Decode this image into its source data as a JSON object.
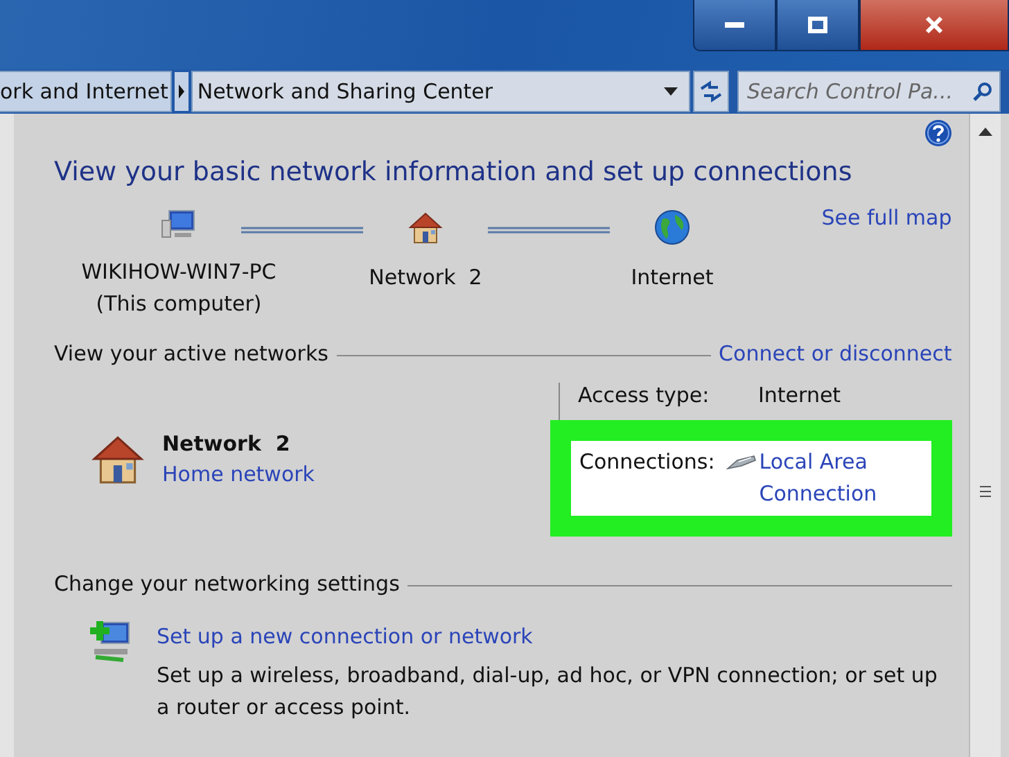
{
  "address_bar": {
    "breadcrumbs": [
      {
        "label": "ork and Internet"
      },
      {
        "label": "Network and Sharing Center"
      }
    ],
    "search": {
      "placeholder": "Search Control Pa..."
    }
  },
  "heading": "View your basic network information and set up connections",
  "map": {
    "link": "See full map",
    "nodes": [
      {
        "kind": "computer",
        "label": "WIKIHOW-WIN7-PC",
        "sublabel": "(This computer)"
      },
      {
        "kind": "house",
        "label": "Network  2"
      },
      {
        "kind": "globe",
        "label": "Internet"
      }
    ]
  },
  "active_networks": {
    "title": "View your active networks",
    "link": "Connect or disconnect",
    "network": {
      "name": "Network  2",
      "type": "Home network"
    },
    "details": [
      {
        "kind": "text",
        "label": "Access type:",
        "value": "Internet",
        "highlighted": false
      },
      {
        "kind": "connection",
        "label": "Connections:",
        "value": "Local Area Connection",
        "highlighted": true
      }
    ]
  },
  "settings": {
    "title": "Change your networking settings",
    "items": [
      {
        "title": "Set up a new connection or network",
        "description": "Set up a wireless, broadband, dial-up, ad hoc, or VPN connection; or set up a router or access point."
      }
    ]
  }
}
